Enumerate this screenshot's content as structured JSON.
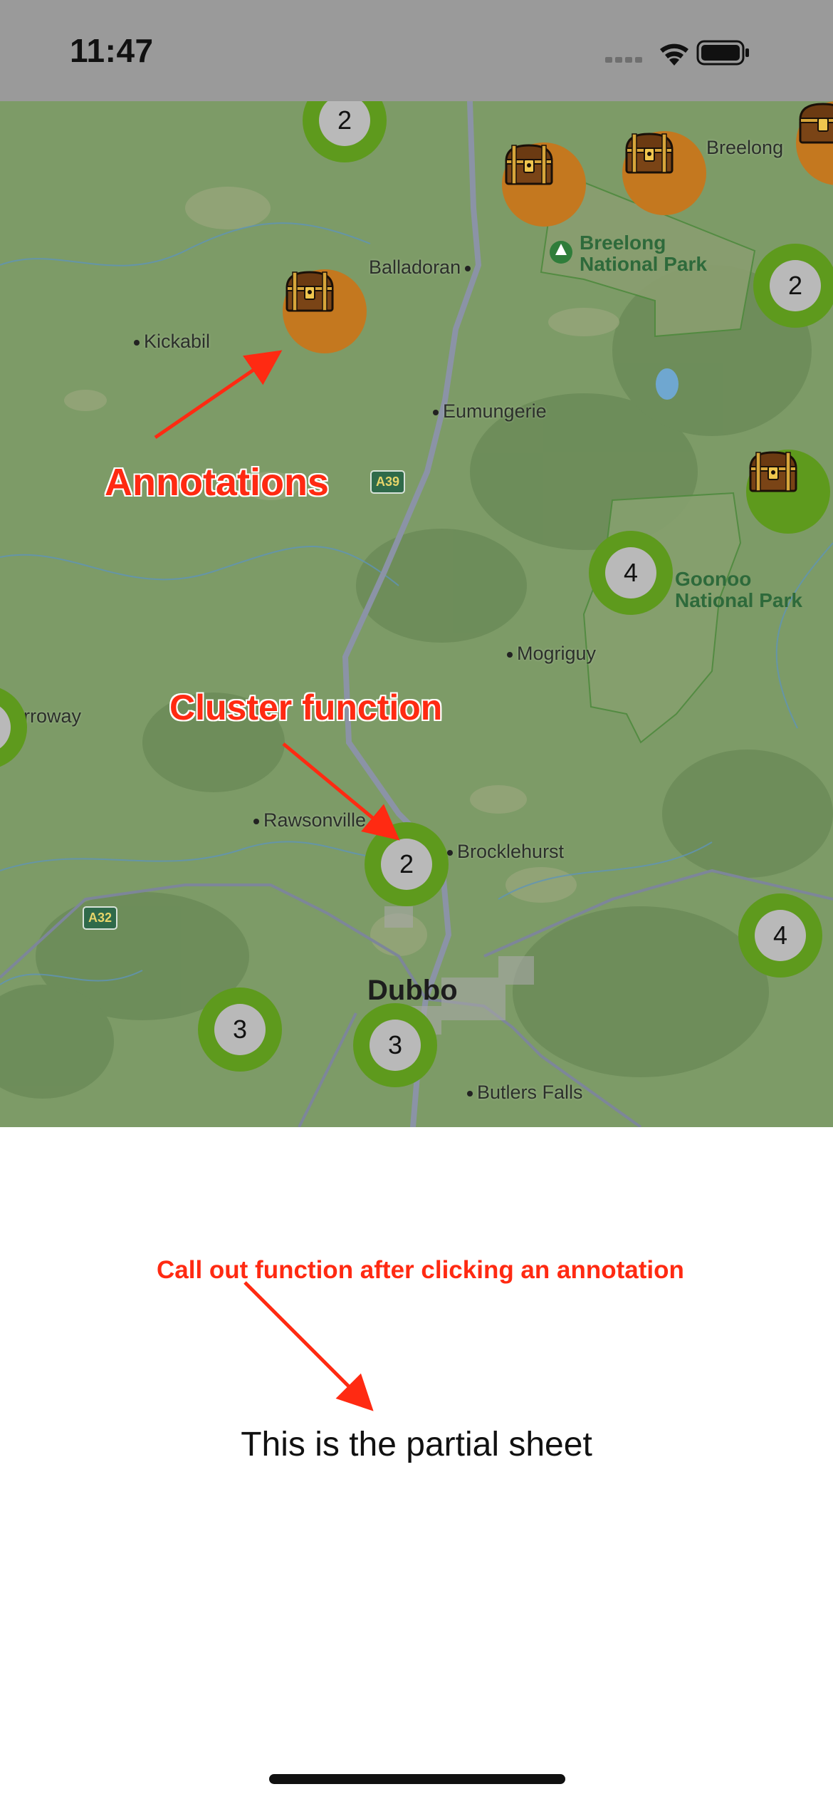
{
  "status_bar": {
    "time": "11:47"
  },
  "map": {
    "places": {
      "kickabil": "Kickabil",
      "balladoran": "Balladoran",
      "breelong": "Breelong",
      "eumungerie": "Eumungerie",
      "mogriguy": "Mogriguy",
      "rawsonville": "Rawsonville",
      "brocklehurst": "Brocklehurst",
      "burroway": "Burroway",
      "butlers_falls": "Butlers Falls",
      "dubbo": "Dubbo"
    },
    "parks": {
      "breelong_np_line1": "Breelong",
      "breelong_np_line2": "National Park",
      "goonoo_np_line1": "Goonoo",
      "goonoo_np_line2": "National Park"
    },
    "road_shields": {
      "a39": "A39",
      "a32": "A32"
    },
    "clusters": {
      "top_left": "2",
      "right_upper": "2",
      "goonoo": "4",
      "brocklehurst": "2",
      "right_lower": "4",
      "dubbo_left": "3",
      "dubbo_center": "3"
    },
    "annotation_icon": "treasure-chest-icon",
    "colors": {
      "cluster_ring": "#5e9a1d",
      "annotation_bg": "#c4781f",
      "cluster_inner": "#b9b9b9"
    }
  },
  "overlay_labels": {
    "annotations": "Annotations",
    "cluster_function": "Cluster function",
    "callout_function": "Call out function after clicking an annotation",
    "color": "#ff2a12"
  },
  "sheet": {
    "text": "This is the partial sheet"
  }
}
